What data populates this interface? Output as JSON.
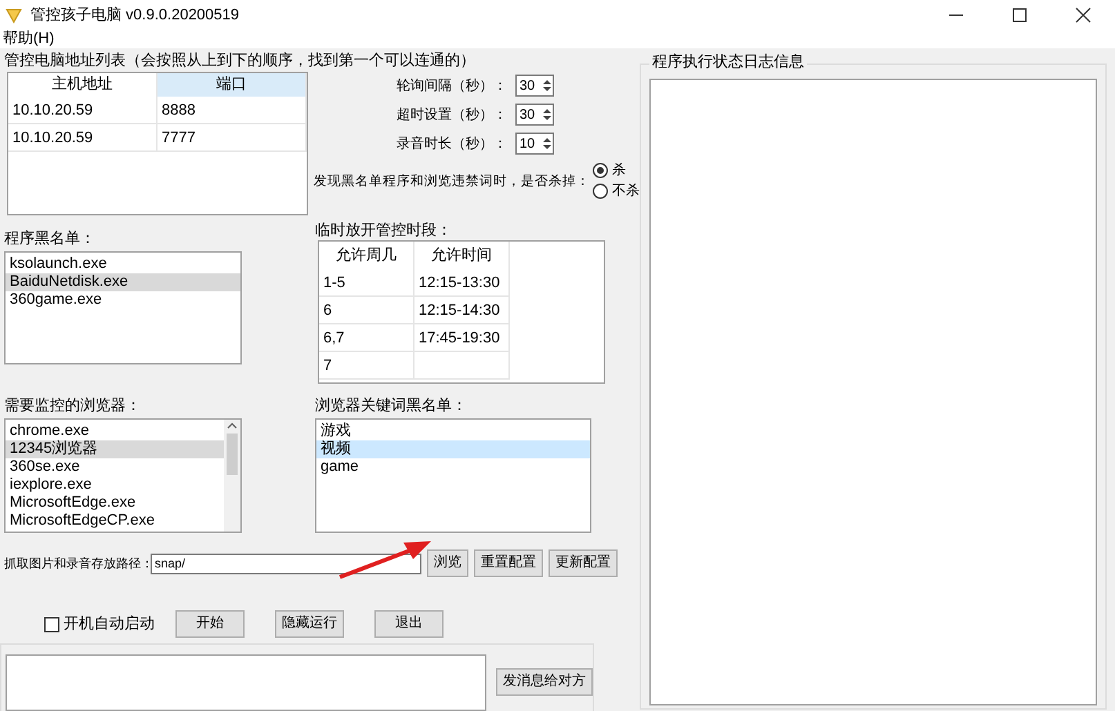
{
  "window": {
    "title": "管控孩子电脑 v0.9.0.20200519"
  },
  "menu": [
    "帮助(H)"
  ],
  "address_list": {
    "label": "管控电脑地址列表（会按照从上到下的顺序，找到第一个可以连通的）",
    "columns": [
      "主机地址",
      "端口"
    ],
    "rows": [
      [
        "10.10.20.59",
        "8888"
      ],
      [
        "10.10.20.59",
        "7777"
      ]
    ]
  },
  "spinners": [
    {
      "label": "轮询间隔（秒）：",
      "value": "30"
    },
    {
      "label": "超时设置（秒）：",
      "value": "30"
    },
    {
      "label": "录音时长（秒）：",
      "value": "10"
    }
  ],
  "kill_option": {
    "label": "发现黑名单程序和浏览违禁词时，是否杀掉：",
    "options": [
      {
        "label": "杀",
        "selected": true
      },
      {
        "label": "不杀",
        "selected": false
      }
    ]
  },
  "temp_open": {
    "label": "临时放开管控时段：",
    "columns": [
      "允许周几",
      "允许时间"
    ],
    "rows": [
      [
        "1-5",
        "12:15-13:30"
      ],
      [
        "6",
        "12:15-14:30"
      ],
      [
        "6,7",
        "17:45-19:30"
      ],
      [
        "7"
      ]
    ]
  },
  "blacklist": {
    "label": "程序黑名单：",
    "items": [
      {
        "text": "ksolaunch.exe",
        "selected": false
      },
      {
        "text": "BaiduNetdisk.exe",
        "selected": true
      },
      {
        "text": "360game.exe",
        "selected": false
      }
    ]
  },
  "browsers": {
    "label": "需要监控的浏览器：",
    "items": [
      {
        "text": "chrome.exe",
        "selected": false
      },
      {
        "text": "12345浏览器",
        "selected": true
      },
      {
        "text": "360se.exe",
        "selected": false
      },
      {
        "text": "iexplore.exe",
        "selected": false
      },
      {
        "text": "MicrosoftEdge.exe",
        "selected": false
      },
      {
        "text": "MicrosoftEdgeCP.exe",
        "selected": false
      }
    ]
  },
  "keywords": {
    "label": "浏览器关键词黑名单：",
    "items": [
      {
        "text": "游戏",
        "selected": false
      },
      {
        "text": "视频",
        "selected": true
      },
      {
        "text": "game",
        "selected": false
      }
    ]
  },
  "path": {
    "label": "抓取图片和录音存放路径：",
    "value": "snap/",
    "buttons": [
      "浏览",
      "重置配置",
      "更新配置"
    ]
  },
  "autostart": {
    "label": "开机自动启动",
    "checked": false
  },
  "actions": [
    "开始",
    "隐藏运行",
    "退出"
  ],
  "message": {
    "button": "发消息给对方"
  },
  "log": {
    "label": "程序执行状态日志信息"
  }
}
